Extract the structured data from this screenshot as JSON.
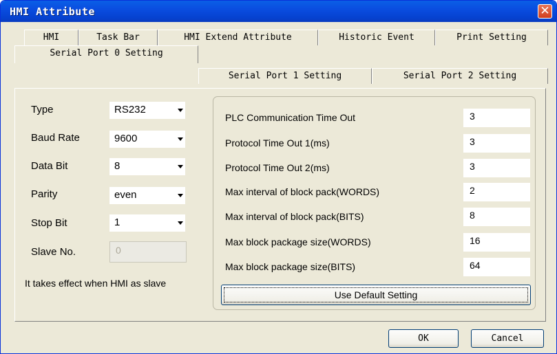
{
  "window": {
    "title": "HMI Attribute"
  },
  "tabs_row1": [
    {
      "label": "HMI"
    },
    {
      "label": "Task Bar"
    },
    {
      "label": "HMI Extend Attribute"
    },
    {
      "label": "Historic Event"
    },
    {
      "label": "Print Setting"
    }
  ],
  "tabs_row2": [
    {
      "label": "Serial Port 0 Setting",
      "active": true
    },
    {
      "label": "Serial Port 1 Setting"
    },
    {
      "label": "Serial Port 2 Setting"
    }
  ],
  "left": {
    "type": {
      "label": "Type",
      "value": "RS232"
    },
    "baud": {
      "label": "Baud Rate",
      "value": "9600"
    },
    "databit": {
      "label": "Data Bit",
      "value": "8"
    },
    "parity": {
      "label": "Parity",
      "value": "even"
    },
    "stopbit": {
      "label": "Stop Bit",
      "value": "1"
    },
    "slave": {
      "label": "Slave No.",
      "value": "0"
    },
    "note": "It takes effect when HMI as slave"
  },
  "right": {
    "rows": [
      {
        "label": "PLC Communication Time Out",
        "value": "3"
      },
      {
        "label": "Protocol Time Out 1(ms)",
        "value": "3"
      },
      {
        "label": "Protocol Time Out 2(ms)",
        "value": "3"
      },
      {
        "label": "Max interval of block pack(WORDS)",
        "value": "2"
      },
      {
        "label": "Max interval of block pack(BITS)",
        "value": "8"
      },
      {
        "label": "Max block package size(WORDS)",
        "value": "16"
      },
      {
        "label": "Max block package size(BITS)",
        "value": "64"
      }
    ],
    "default_button": "Use Default Setting"
  },
  "buttons": {
    "ok": "OK",
    "cancel": "Cancel"
  },
  "colors": {
    "titlebar": "#0a4de0",
    "face": "#ece9d8",
    "close": "#d13e1c"
  }
}
